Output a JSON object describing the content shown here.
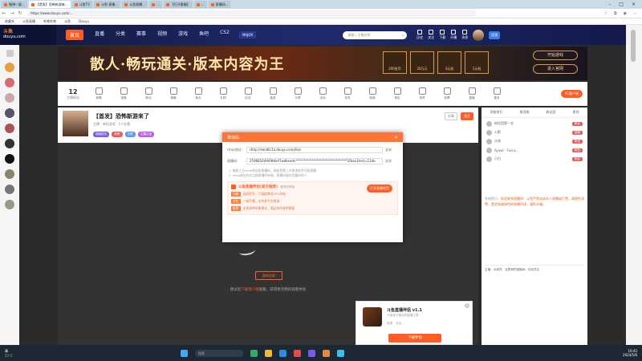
{
  "browser": {
    "tabs": [
      "微博—夏...",
      "【首发】恐怖新游来...",
      "斗鱼TV",
      "斗鱼-直播...",
      "斗鱼直播...",
      "...",
      "【打开客服】",
      "...",
      "直播间..."
    ],
    "url": "https://www.douyu.com/...",
    "bookmarks": [
      "收藏夹",
      "斗鱼直播",
      "哔哩哔哩",
      "斗鱼",
      "Douyu"
    ]
  },
  "header": {
    "logo_top": "斗鱼",
    "logo_sub": "douyu.com",
    "nav": [
      "首页",
      "直播",
      "分类",
      "赛事",
      "视频",
      "游戏",
      "鱼吧",
      "CS2"
    ],
    "badge": "MAJOR",
    "search_placeholder": "请输入主播名称",
    "icons": [
      "历史",
      "关注",
      "下载",
      "开播",
      "消息"
    ],
    "upload": "回到"
  },
  "banner": {
    "title": "散人·畅玩通关·版本内容为王",
    "items": [
      "200金币",
      "20万元",
      "3元机",
      "1元机"
    ],
    "buttons": [
      "开始游戏",
      "进入官网"
    ]
  },
  "toolbar": {
    "count": "12",
    "count_label": "主播粉丝",
    "tools": [
      "竞猜",
      "宝箱",
      "粉丝",
      "弹幕",
      "鱼丸",
      "礼物",
      "红包",
      "抽奖",
      "分享",
      "活动",
      "任务",
      "商城",
      "背包",
      "贵宾",
      "投票",
      "直播",
      "更多"
    ],
    "pc_button": "PC客户端"
  },
  "room": {
    "title": "【首发】恐怖新游来了",
    "sub": "主播 ·  单机游戏 ·  1人在看",
    "tags": [
      "超级粉丝",
      "老粉",
      "日常",
      "主播认证"
    ],
    "share": [
      "分享",
      "关注"
    ]
  },
  "video": {
    "reopen": "重新加载",
    "hint_prefix": "建议您",
    "hint_link": "下载客户端",
    "hint_suffix": "观看，获得更流畅的观看体验"
  },
  "right_panel": {
    "tabs": [
      "贡献排行",
      "周贡献",
      "粉丝团",
      "贵宾"
    ],
    "ranks": [
      {
        "name": "粉丝团第一名",
        "badge": "粉丝"
      },
      {
        "name": "火影",
        "badge": "超级"
      },
      {
        "name": "大佬",
        "badge": "粉丝"
      },
      {
        "name": "Ayawi · Focus...",
        "badge": "粉丝"
      },
      {
        "name": "小白",
        "badge": "粉丝"
      }
    ],
    "chat_user": "系统提示：",
    "chat": "欢迎来到直播间！斗鱼严禁未成年人直播或打赏，请理性消费，营造和谐绿色的直播环境，谨防诈骗。",
    "notice": "主播：大家好，这是我的直播间，欢迎关注"
  },
  "dialog": {
    "title": "推流码",
    "close": "×",
    "rtmp_label": "rtmp地址:",
    "rtmp_value": "rtmp://sendtc1a.douyu.com/live",
    "code_label": "直播码:",
    "code_value": "2596854d949b6ef7wdbcedn********************************1fbaa1test=12da",
    "copy": "复制",
    "notes": [
      "1. 复制上方rtmp地址和直播码，粘贴到第三方推流软件开始直播",
      "2. rtmp地址仅对当前直播间有效，直播码请勿泄露给他人"
    ],
    "promo_title": "斗鱼直播伴侣(官方推荐)",
    "promo_hint": "更好的体验",
    "promo_button": "打开直播伴侣",
    "features": [
      {
        "tag": "功能",
        "text": "画质提升，大幅度降低CPU消耗"
      },
      {
        "tag": "优化",
        "text": "一键开播，支持多平台推流"
      },
      {
        "tag": "推荐",
        "text": "支持多种场景模式，满足你的各种需要"
      }
    ]
  },
  "app_card": {
    "name": "斗鱼直播伴侣 v1.1",
    "desc": "斗鱼官方推出的直播工具",
    "tags": [
      "免费",
      "安全"
    ],
    "download": "下载伴侣",
    "close": "×"
  },
  "taskbar": {
    "weather": "晴",
    "weather_sub": "25°C",
    "search": "搜索",
    "time": "10:42",
    "date": "2024/5/6"
  }
}
